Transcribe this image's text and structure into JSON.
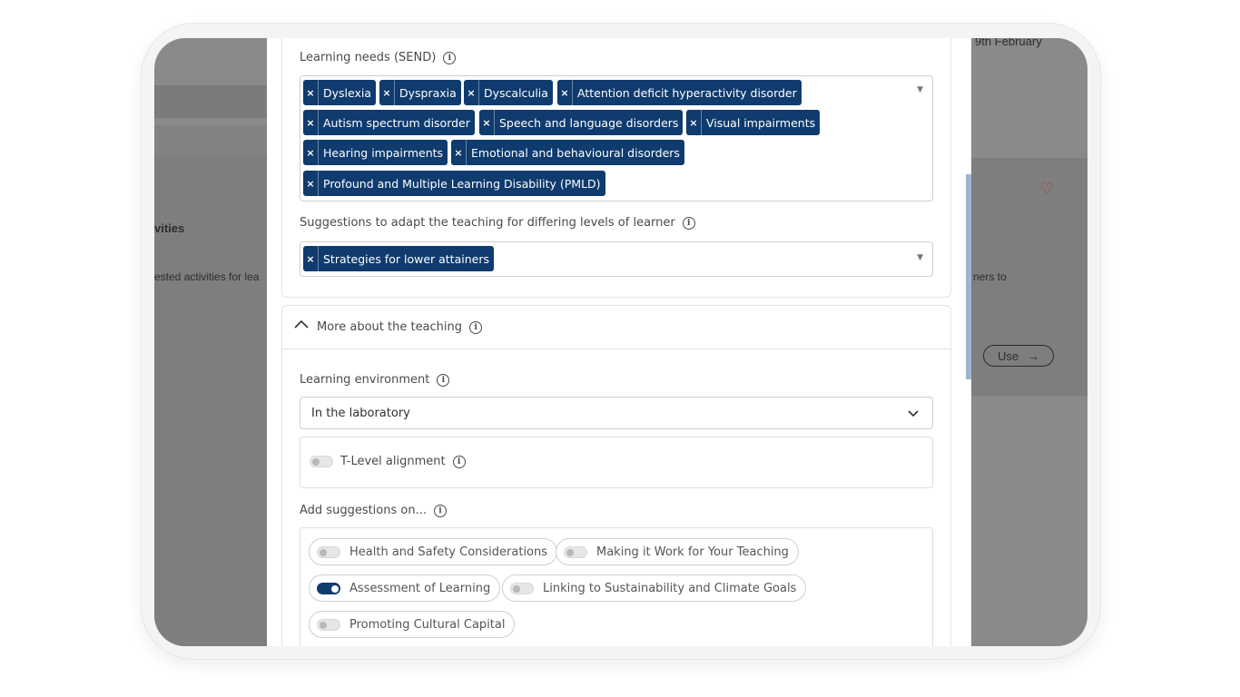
{
  "background": {
    "header_date": "9th February",
    "left_label": "vities",
    "left_desc": "ested activities for lea",
    "right_desc": "ners to",
    "use_label": "Use",
    "use_arrow": "→",
    "heart": "♡"
  },
  "learning_needs": {
    "label": "Learning needs (SEND)",
    "tags": [
      "Dyslexia",
      "Dyspraxia",
      "Dyscalculia",
      "Attention deficit hyperactivity disorder",
      "Autism spectrum disorder",
      "Speech and language disorders",
      "Visual impairments",
      "Hearing impairments",
      "Emotional and behavioural disorders",
      "Profound and Multiple Learning Disability (PMLD)"
    ],
    "remove_glyph": "×"
  },
  "suggestions": {
    "label": "Suggestions to adapt the teaching for differing levels of learner",
    "tags": [
      "Strategies for lower attainers"
    ]
  },
  "more_section": {
    "title": "More about the teaching",
    "learning_env_label": "Learning environment",
    "learning_env_value": "In the laboratory",
    "tlevel_label": "T-Level alignment",
    "tlevel_on": false,
    "add_suggestions_label": "Add suggestions on...",
    "options": [
      {
        "label": "Health and Safety Considerations",
        "on": false
      },
      {
        "label": "Making it Work for Your Teaching",
        "on": false
      },
      {
        "label": "Assessment of Learning",
        "on": true
      },
      {
        "label": "Linking to Sustainability and Climate Goals",
        "on": false
      },
      {
        "label": "Promoting Cultural Capital",
        "on": false
      }
    ]
  },
  "icons": {
    "info": "i",
    "caret": "▼",
    "chevron_down": "⌄",
    "chevron_up": "^"
  }
}
